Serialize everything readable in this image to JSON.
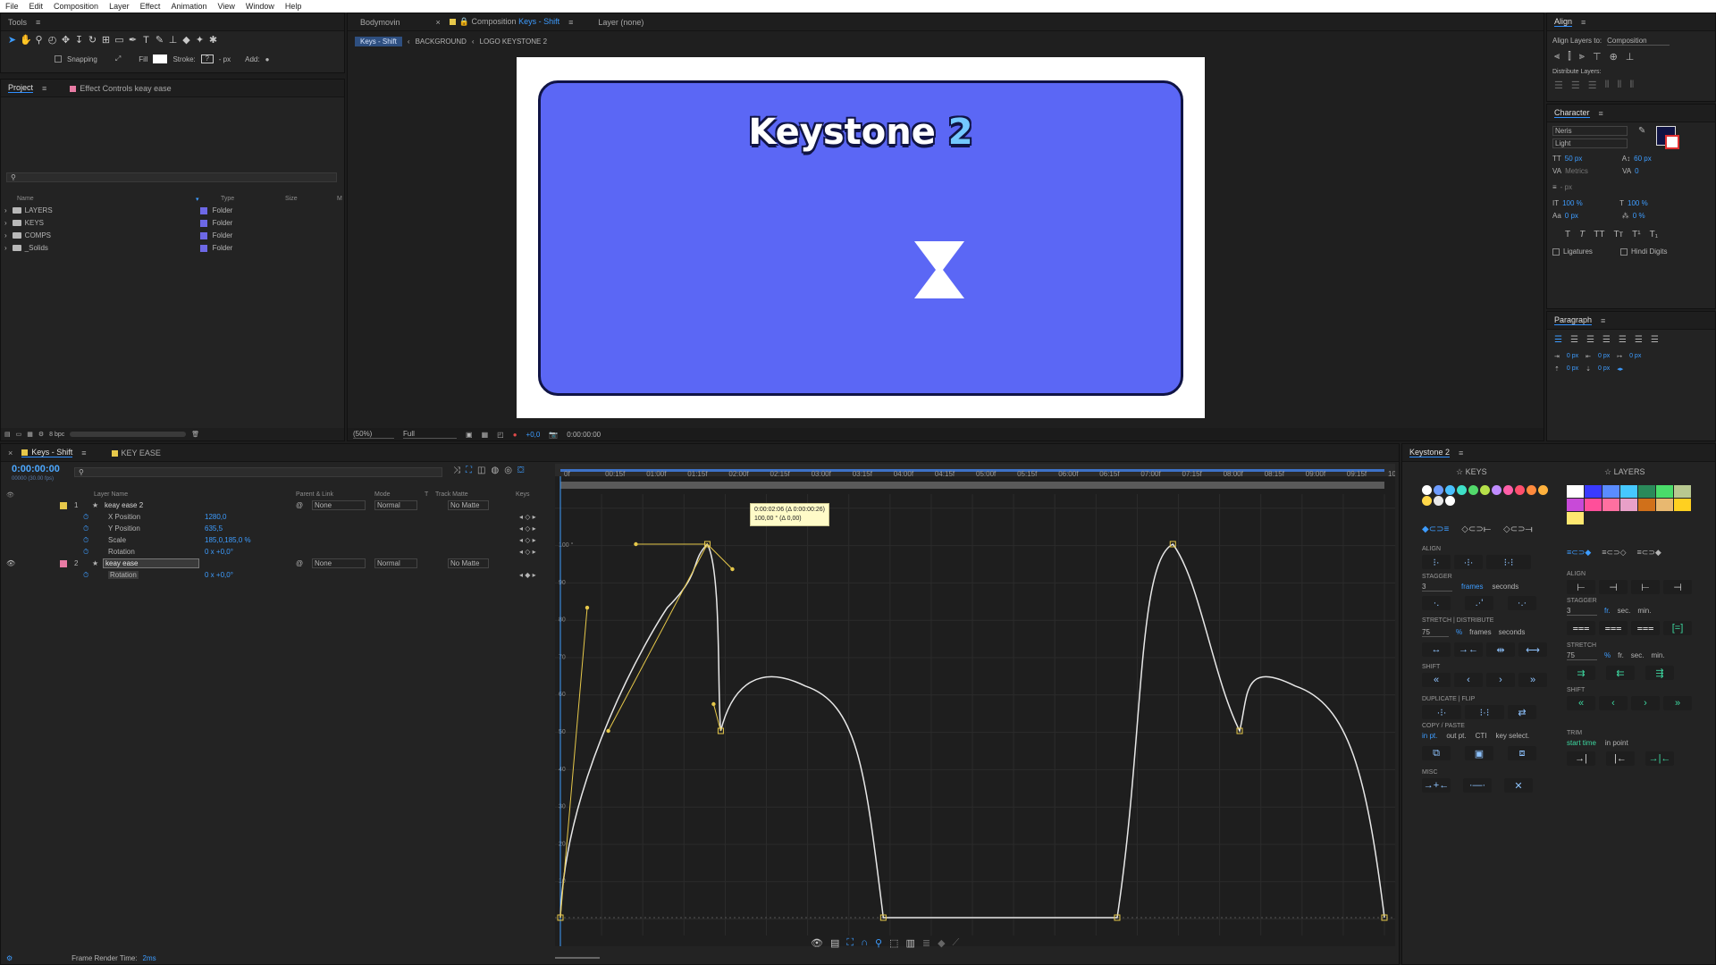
{
  "menu": [
    "File",
    "Edit",
    "Composition",
    "Layer",
    "Effect",
    "Animation",
    "View",
    "Window",
    "Help"
  ],
  "tools_panel": {
    "title": "Tools",
    "snapping": "Snapping",
    "fill": "Fill",
    "stroke": "Stroke:",
    "stroke_unit": "- px",
    "add": "Add:"
  },
  "project": {
    "tab": "Project",
    "tab2": "Effect Controls keay ease",
    "columns": {
      "name": "Name",
      "type": "Type",
      "size": "Size",
      "m": "M"
    },
    "items": [
      {
        "name": "LAYERS",
        "type": "Folder"
      },
      {
        "name": "KEYS",
        "type": "Folder"
      },
      {
        "name": "COMPS",
        "type": "Folder"
      },
      {
        "name": "_Solids",
        "type": "Folder"
      }
    ],
    "bpc": "8 bpc"
  },
  "viewer": {
    "tabs": {
      "bodymovin": "Bodymovin",
      "comp_prefix": "Composition",
      "comp_name": "Keys - Shift",
      "layer": "Layer (none)"
    },
    "breadcrumb": [
      "Keys - Shift",
      "BACKGROUND",
      "LOGO KEYSTONE 2"
    ],
    "logo_text": "Keystone",
    "logo_num": "2",
    "zoom": "(50%)",
    "quality": "Full",
    "exposure": "+0,0",
    "time": "0:00:00:00",
    "bg_color": "#5b67f5"
  },
  "timeline": {
    "tab": "Keys - Shift",
    "tab2": "KEY EASE",
    "timecode": "0:00:00:00",
    "timecode_sub": "00000 (30.00 fps)",
    "cols": {
      "layer": "Layer Name",
      "parent": "Parent & Link",
      "mode": "Mode",
      "t": "T",
      "matte": "Track Matte",
      "keys": "Keys"
    },
    "layers": [
      {
        "num": "1",
        "name": "keay ease 2",
        "parent": "None",
        "mode": "Normal",
        "matte": "No Matte",
        "label": "#e6c84a"
      },
      {
        "num": "2",
        "name": "keay ease",
        "parent": "None",
        "mode": "Normal",
        "matte": "No Matte",
        "label": "#e87ba4"
      }
    ],
    "props": [
      {
        "name": "X Position",
        "value": "1280,0"
      },
      {
        "name": "Y Position",
        "value": "635,5"
      },
      {
        "name": "Scale",
        "value": "185,0,185,0 %"
      },
      {
        "name": "Rotation",
        "value": "0 x +0,0°"
      }
    ],
    "prop2": {
      "name": "Rotation",
      "value": "0 x +0,0°"
    },
    "ruler": [
      "0f",
      "00:15f",
      "01:00f",
      "01:15f",
      "02:00f",
      "02:15f",
      "03:00f",
      "03:15f",
      "04:00f",
      "04:15f",
      "05:00f",
      "05:15f",
      "06:00f",
      "06:15f",
      "07:00f",
      "07:15f",
      "08:00f",
      "08:15f",
      "09:00f",
      "09:15f",
      "10:0"
    ],
    "y_labels": [
      "100 °",
      "90",
      "80",
      "70",
      "60",
      "50",
      "40",
      "30",
      "20",
      "10"
    ],
    "tooltip": [
      "0:00:02:06 (Δ 0:00:00:26)",
      "100,00 ° (Δ 0,00)"
    ],
    "render_label": "Frame Render Time:",
    "render_value": "2ms"
  },
  "graph": {
    "type": "line",
    "title": "",
    "xlabel": "",
    "ylabel": "",
    "x_unit": "frames (30 fps)",
    "xlim": [
      0,
      300
    ],
    "ylim": [
      0,
      100
    ],
    "points": [
      [
        0,
        0
      ],
      [
        48,
        83
      ],
      [
        66,
        100
      ],
      [
        72,
        50
      ],
      [
        110,
        62
      ],
      [
        145,
        0
      ],
      [
        250,
        0
      ],
      [
        275,
        100
      ],
      [
        305,
        50
      ],
      [
        330,
        62
      ],
      [
        370,
        0
      ]
    ]
  },
  "right": {
    "align": {
      "title": "Align",
      "align_to_label": "Align Layers to:",
      "align_to": "Composition",
      "distribute": "Distribute Layers:"
    },
    "character": {
      "title": "Character",
      "font": "Neris",
      "style": "Light",
      "size": "50 px",
      "leading": "60 px",
      "kerning": "Metrics",
      "tracking": "0",
      "stroke": "- px",
      "vscale": "100 %",
      "hscale": "100 %",
      "baseline": "0 px",
      "tsume": "0 %",
      "ligatures": "Ligatures",
      "hindi": "Hindi Digits"
    },
    "paragraph": {
      "title": "Paragraph",
      "px": "0 px"
    }
  },
  "keystone": {
    "title": "Keystone 2",
    "keys_tab": "KEYS",
    "layers_tab": "LAYERS",
    "align": "ALIGN",
    "stagger": "STAGGER",
    "stagger_val": "3",
    "frames": "frames",
    "seconds": "seconds",
    "stretch": "STRETCH",
    "distribute": "DISTRIBUTE",
    "stretch_val": "75",
    "pct": "%",
    "shift": "SHIFT",
    "duplicate": "DUPLICATE",
    "flip": "FLIP",
    "copy": "COPY / PASTE",
    "copy_opts": [
      "in pt.",
      "out pt.",
      "CTI",
      "key select."
    ],
    "misc": "MISC",
    "l_align": "ALIGN",
    "l_stagger": "STAGGER",
    "l_stagger_val": "3",
    "fr": "fr.",
    "sec": "sec.",
    "min": "min.",
    "l_stretch": "STRETCH",
    "l_stretch_val": "75",
    "l_shift": "SHIFT",
    "trim": "TRIM",
    "start_time": "start time",
    "in_point": "in point",
    "key_dots": [
      "#ffffff",
      "#6e9cff",
      "#4ac0ff",
      "#3ee0c8",
      "#52d96b",
      "#b6e04a",
      "#c08cff",
      "#ff5fa8",
      "#ff4f6e",
      "#ff8a3d",
      "#ffb13d",
      "#ffd84a",
      "#e8e8e8",
      "#ffffff"
    ],
    "layer_colors": [
      "#ffffff",
      "#3a3aff",
      "#5a8cff",
      "#46c8ff",
      "#2a8a5a",
      "#4adc6a",
      "#b8c890",
      "#c84ad8",
      "#ff4f9a",
      "#ff70a0",
      "#e8a0c8",
      "#d0701a",
      "#e8b870",
      "#ffd020",
      "#ffe870"
    ]
  }
}
